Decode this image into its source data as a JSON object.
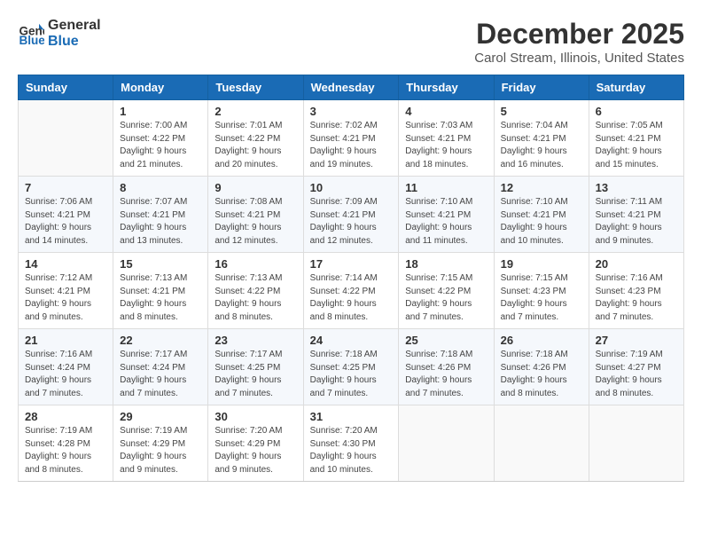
{
  "header": {
    "logo": {
      "line1": "General",
      "line2": "Blue"
    },
    "title": "December 2025",
    "location": "Carol Stream, Illinois, United States"
  },
  "weekdays": [
    "Sunday",
    "Monday",
    "Tuesday",
    "Wednesday",
    "Thursday",
    "Friday",
    "Saturday"
  ],
  "weeks": [
    [
      {
        "day": "",
        "sunrise": "",
        "sunset": "",
        "daylight": ""
      },
      {
        "day": "1",
        "sunrise": "Sunrise: 7:00 AM",
        "sunset": "Sunset: 4:22 PM",
        "daylight": "Daylight: 9 hours and 21 minutes."
      },
      {
        "day": "2",
        "sunrise": "Sunrise: 7:01 AM",
        "sunset": "Sunset: 4:22 PM",
        "daylight": "Daylight: 9 hours and 20 minutes."
      },
      {
        "day": "3",
        "sunrise": "Sunrise: 7:02 AM",
        "sunset": "Sunset: 4:21 PM",
        "daylight": "Daylight: 9 hours and 19 minutes."
      },
      {
        "day": "4",
        "sunrise": "Sunrise: 7:03 AM",
        "sunset": "Sunset: 4:21 PM",
        "daylight": "Daylight: 9 hours and 18 minutes."
      },
      {
        "day": "5",
        "sunrise": "Sunrise: 7:04 AM",
        "sunset": "Sunset: 4:21 PM",
        "daylight": "Daylight: 9 hours and 16 minutes."
      },
      {
        "day": "6",
        "sunrise": "Sunrise: 7:05 AM",
        "sunset": "Sunset: 4:21 PM",
        "daylight": "Daylight: 9 hours and 15 minutes."
      }
    ],
    [
      {
        "day": "7",
        "sunrise": "Sunrise: 7:06 AM",
        "sunset": "Sunset: 4:21 PM",
        "daylight": "Daylight: 9 hours and 14 minutes."
      },
      {
        "day": "8",
        "sunrise": "Sunrise: 7:07 AM",
        "sunset": "Sunset: 4:21 PM",
        "daylight": "Daylight: 9 hours and 13 minutes."
      },
      {
        "day": "9",
        "sunrise": "Sunrise: 7:08 AM",
        "sunset": "Sunset: 4:21 PM",
        "daylight": "Daylight: 9 hours and 12 minutes."
      },
      {
        "day": "10",
        "sunrise": "Sunrise: 7:09 AM",
        "sunset": "Sunset: 4:21 PM",
        "daylight": "Daylight: 9 hours and 12 minutes."
      },
      {
        "day": "11",
        "sunrise": "Sunrise: 7:10 AM",
        "sunset": "Sunset: 4:21 PM",
        "daylight": "Daylight: 9 hours and 11 minutes."
      },
      {
        "day": "12",
        "sunrise": "Sunrise: 7:10 AM",
        "sunset": "Sunset: 4:21 PM",
        "daylight": "Daylight: 9 hours and 10 minutes."
      },
      {
        "day": "13",
        "sunrise": "Sunrise: 7:11 AM",
        "sunset": "Sunset: 4:21 PM",
        "daylight": "Daylight: 9 hours and 9 minutes."
      }
    ],
    [
      {
        "day": "14",
        "sunrise": "Sunrise: 7:12 AM",
        "sunset": "Sunset: 4:21 PM",
        "daylight": "Daylight: 9 hours and 9 minutes."
      },
      {
        "day": "15",
        "sunrise": "Sunrise: 7:13 AM",
        "sunset": "Sunset: 4:21 PM",
        "daylight": "Daylight: 9 hours and 8 minutes."
      },
      {
        "day": "16",
        "sunrise": "Sunrise: 7:13 AM",
        "sunset": "Sunset: 4:22 PM",
        "daylight": "Daylight: 9 hours and 8 minutes."
      },
      {
        "day": "17",
        "sunrise": "Sunrise: 7:14 AM",
        "sunset": "Sunset: 4:22 PM",
        "daylight": "Daylight: 9 hours and 8 minutes."
      },
      {
        "day": "18",
        "sunrise": "Sunrise: 7:15 AM",
        "sunset": "Sunset: 4:22 PM",
        "daylight": "Daylight: 9 hours and 7 minutes."
      },
      {
        "day": "19",
        "sunrise": "Sunrise: 7:15 AM",
        "sunset": "Sunset: 4:23 PM",
        "daylight": "Daylight: 9 hours and 7 minutes."
      },
      {
        "day": "20",
        "sunrise": "Sunrise: 7:16 AM",
        "sunset": "Sunset: 4:23 PM",
        "daylight": "Daylight: 9 hours and 7 minutes."
      }
    ],
    [
      {
        "day": "21",
        "sunrise": "Sunrise: 7:16 AM",
        "sunset": "Sunset: 4:24 PM",
        "daylight": "Daylight: 9 hours and 7 minutes."
      },
      {
        "day": "22",
        "sunrise": "Sunrise: 7:17 AM",
        "sunset": "Sunset: 4:24 PM",
        "daylight": "Daylight: 9 hours and 7 minutes."
      },
      {
        "day": "23",
        "sunrise": "Sunrise: 7:17 AM",
        "sunset": "Sunset: 4:25 PM",
        "daylight": "Daylight: 9 hours and 7 minutes."
      },
      {
        "day": "24",
        "sunrise": "Sunrise: 7:18 AM",
        "sunset": "Sunset: 4:25 PM",
        "daylight": "Daylight: 9 hours and 7 minutes."
      },
      {
        "day": "25",
        "sunrise": "Sunrise: 7:18 AM",
        "sunset": "Sunset: 4:26 PM",
        "daylight": "Daylight: 9 hours and 7 minutes."
      },
      {
        "day": "26",
        "sunrise": "Sunrise: 7:18 AM",
        "sunset": "Sunset: 4:26 PM",
        "daylight": "Daylight: 9 hours and 8 minutes."
      },
      {
        "day": "27",
        "sunrise": "Sunrise: 7:19 AM",
        "sunset": "Sunset: 4:27 PM",
        "daylight": "Daylight: 9 hours and 8 minutes."
      }
    ],
    [
      {
        "day": "28",
        "sunrise": "Sunrise: 7:19 AM",
        "sunset": "Sunset: 4:28 PM",
        "daylight": "Daylight: 9 hours and 8 minutes."
      },
      {
        "day": "29",
        "sunrise": "Sunrise: 7:19 AM",
        "sunset": "Sunset: 4:29 PM",
        "daylight": "Daylight: 9 hours and 9 minutes."
      },
      {
        "day": "30",
        "sunrise": "Sunrise: 7:20 AM",
        "sunset": "Sunset: 4:29 PM",
        "daylight": "Daylight: 9 hours and 9 minutes."
      },
      {
        "day": "31",
        "sunrise": "Sunrise: 7:20 AM",
        "sunset": "Sunset: 4:30 PM",
        "daylight": "Daylight: 9 hours and 10 minutes."
      },
      {
        "day": "",
        "sunrise": "",
        "sunset": "",
        "daylight": ""
      },
      {
        "day": "",
        "sunrise": "",
        "sunset": "",
        "daylight": ""
      },
      {
        "day": "",
        "sunrise": "",
        "sunset": "",
        "daylight": ""
      }
    ]
  ]
}
